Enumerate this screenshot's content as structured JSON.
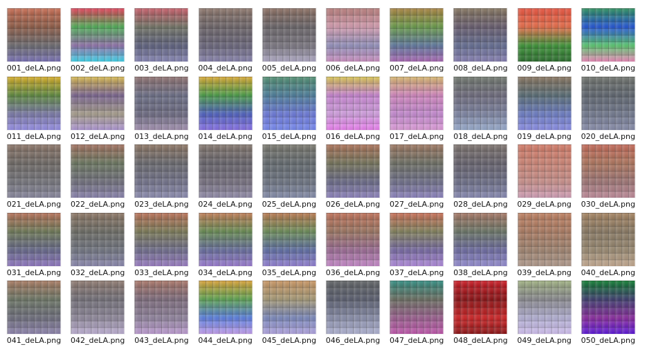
{
  "thumbnails": [
    {
      "filename": "001_deLA.png",
      "palette": [
        "#c96d53",
        "#8f5d48",
        "#6b6a6f",
        "#7b73b8"
      ]
    },
    {
      "filename": "002_deLA.png",
      "palette": [
        "#e23f58",
        "#52b05a",
        "#8f70a8",
        "#43d7ee"
      ]
    },
    {
      "filename": "003_deLA.png",
      "palette": [
        "#c75c68",
        "#737567",
        "#5d607d",
        "#8a89b8"
      ]
    },
    {
      "filename": "004_deLA.png",
      "palette": [
        "#8d766b",
        "#6d6569",
        "#69657a",
        "#8b86b0"
      ]
    },
    {
      "filename": "005_deLA.png",
      "palette": [
        "#8c6f62",
        "#6a6569",
        "#7a7680",
        "#b2acc8"
      ]
    },
    {
      "filename": "006_deLA.png",
      "palette": [
        "#b57a78",
        "#d59eb1",
        "#9290bb",
        "#cf93c4"
      ]
    },
    {
      "filename": "007_deLA.png",
      "palette": [
        "#a8813f",
        "#6b9c4c",
        "#5f779d",
        "#ad6bb7"
      ]
    },
    {
      "filename": "008_deLA.png",
      "palette": [
        "#84745e",
        "#695e70",
        "#646d92",
        "#8a82b5"
      ]
    },
    {
      "filename": "009_deLA.png",
      "palette": [
        "#e6513d",
        "#e76e4b",
        "#3d9438",
        "#2c6e2e"
      ]
    },
    {
      "filename": "010_deLA.png",
      "palette": [
        "#2a8e5b",
        "#2657d7",
        "#5ac76f",
        "#ef8cbc"
      ]
    },
    {
      "filename": "011_deLA.png",
      "palette": [
        "#d7ad27",
        "#5f8a40",
        "#7b7aa8",
        "#9a92ea"
      ]
    },
    {
      "filename": "012_deLA.png",
      "palette": [
        "#d8b94f",
        "#7c6692",
        "#a79e8c",
        "#b29ad8"
      ]
    },
    {
      "filename": "013_deLA.png",
      "palette": [
        "#8e706f",
        "#6d7088",
        "#6c6a81",
        "#a694b4"
      ]
    },
    {
      "filename": "014_deLA.png",
      "palette": [
        "#d9a832",
        "#4c9e4a",
        "#4f61bf",
        "#8b74ea"
      ]
    },
    {
      "filename": "015_deLA.png",
      "palette": [
        "#4f8d6f",
        "#4f7f9c",
        "#6d7ad9",
        "#7a8cf3"
      ]
    },
    {
      "filename": "016_deLA.png",
      "palette": [
        "#d8c451",
        "#c986d3",
        "#d1a0df",
        "#ee82f3"
      ]
    },
    {
      "filename": "017_deLA.png",
      "palette": [
        "#d6b56d",
        "#d388c0",
        "#c48ad0",
        "#e19fdc"
      ]
    },
    {
      "filename": "018_deLA.png",
      "palette": [
        "#6f776d",
        "#6f6c7e",
        "#7e85a3",
        "#9baed0"
      ]
    },
    {
      "filename": "019_deLA.png",
      "palette": [
        "#88745e",
        "#596d76",
        "#6d7dc4",
        "#8d90e8"
      ]
    },
    {
      "filename": "020_deLA.png",
      "palette": [
        "#6f736d",
        "#5f6670",
        "#737a8f",
        "#8b90ae"
      ]
    },
    {
      "filename": "021_deLA.png",
      "palette": [
        "#8c7568",
        "#6f6a66",
        "#75757c",
        "#8b8aa1"
      ]
    },
    {
      "filename": "022_deLA.png",
      "palette": [
        "#a2705e",
        "#6c7861",
        "#706f7c",
        "#8d86b1"
      ]
    },
    {
      "filename": "023_deLA.png",
      "palette": [
        "#8d7563",
        "#6a6a6f",
        "#72728a",
        "#8f8fb3"
      ]
    },
    {
      "filename": "024_deLA.png",
      "palette": [
        "#84776e",
        "#67646c",
        "#76707f",
        "#958fad"
      ]
    },
    {
      "filename": "025_deLA.png",
      "palette": [
        "#79786e",
        "#646b70",
        "#6d7482",
        "#8890ae"
      ]
    },
    {
      "filename": "026_deLA.png",
      "palette": [
        "#ac7258",
        "#76755c",
        "#6a6a87",
        "#9287c2"
      ]
    },
    {
      "filename": "027_deLA.png",
      "palette": [
        "#9e7761",
        "#6e7065",
        "#6f6f89",
        "#9187c3"
      ]
    },
    {
      "filename": "028_deLA.png",
      "palette": [
        "#7e746f",
        "#67636e",
        "#6d6f88",
        "#8b8db6"
      ]
    },
    {
      "filename": "029_deLA.png",
      "palette": [
        "#d37a67",
        "#ce8677",
        "#c9908b",
        "#d3a1b9"
      ]
    },
    {
      "filename": "030_deLA.png",
      "palette": [
        "#c36857",
        "#b0775f",
        "#9e7575",
        "#c28e9d"
      ]
    },
    {
      "filename": "031_deLA.png",
      "palette": [
        "#b56f56",
        "#707b59",
        "#66688a",
        "#947bc6"
      ]
    },
    {
      "filename": "032_deLA.png",
      "palette": [
        "#8c7563",
        "#6d6d66",
        "#717581",
        "#8e8bb2"
      ]
    },
    {
      "filename": "033_deLA.png",
      "palette": [
        "#b96f55",
        "#7d7c59",
        "#6f6d8c",
        "#9e80c7"
      ]
    },
    {
      "filename": "034_deLA.png",
      "palette": [
        "#bf7b54",
        "#6a8e55",
        "#676d9d",
        "#9f7fd5"
      ]
    },
    {
      "filename": "035_deLA.png",
      "palette": [
        "#b8774e",
        "#6e8f5b",
        "#5f6ea4",
        "#9683d6"
      ]
    },
    {
      "filename": "036_deLA.png",
      "palette": [
        "#bf6f57",
        "#9d7763",
        "#9b6b94",
        "#c98ccd"
      ]
    },
    {
      "filename": "037_deLA.png",
      "palette": [
        "#c86d55",
        "#84835e",
        "#7669a2",
        "#b48ee0"
      ]
    },
    {
      "filename": "038_deLA.png",
      "palette": [
        "#a57563",
        "#6c7768",
        "#6d6ba1",
        "#9890d4"
      ]
    },
    {
      "filename": "039_deLA.png",
      "palette": [
        "#be7f60",
        "#ad7d64",
        "#a08470",
        "#b49d8f"
      ]
    },
    {
      "filename": "040_deLA.png",
      "palette": [
        "#a58360",
        "#8b7b65",
        "#9a8a72",
        "#c8ad94"
      ]
    },
    {
      "filename": "041_deLA.png",
      "palette": [
        "#a87a61",
        "#6d7766",
        "#6d6d7c",
        "#9288b2"
      ]
    },
    {
      "filename": "042_deLA.png",
      "palette": [
        "#8f7a70",
        "#737079",
        "#8f889b",
        "#c2b4d8"
      ]
    },
    {
      "filename": "043_deLA.png",
      "palette": [
        "#a97567",
        "#7e6c7d",
        "#90839d",
        "#c2a0d7"
      ]
    },
    {
      "filename": "044_deLA.png",
      "palette": [
        "#d9a136",
        "#5fa553",
        "#5a7ee0",
        "#c8a3f2"
      ]
    },
    {
      "filename": "045_deLA.png",
      "palette": [
        "#c99562",
        "#a79b78",
        "#7a88bc",
        "#b6a9e5"
      ]
    },
    {
      "filename": "046_deLA.png",
      "palette": [
        "#5f6264",
        "#5b5f70",
        "#8a8fab",
        "#b4b7d7"
      ]
    },
    {
      "filename": "047_deLA.png",
      "palette": [
        "#2f8b7f",
        "#6b6f62",
        "#9b5f8f",
        "#c35ab0"
      ]
    },
    {
      "filename": "048_deLA.png",
      "palette": [
        "#cc1b25",
        "#8a1215",
        "#cf2527",
        "#8e1618"
      ]
    },
    {
      "filename": "049_deLA.png",
      "palette": [
        "#9fb181",
        "#8a8a8f",
        "#b4b1d5",
        "#d4c3f3"
      ]
    },
    {
      "filename": "050_deLA.png",
      "palette": [
        "#0c7b2e",
        "#3e3f6f",
        "#8a2c9e",
        "#5f1bdb"
      ]
    }
  ]
}
